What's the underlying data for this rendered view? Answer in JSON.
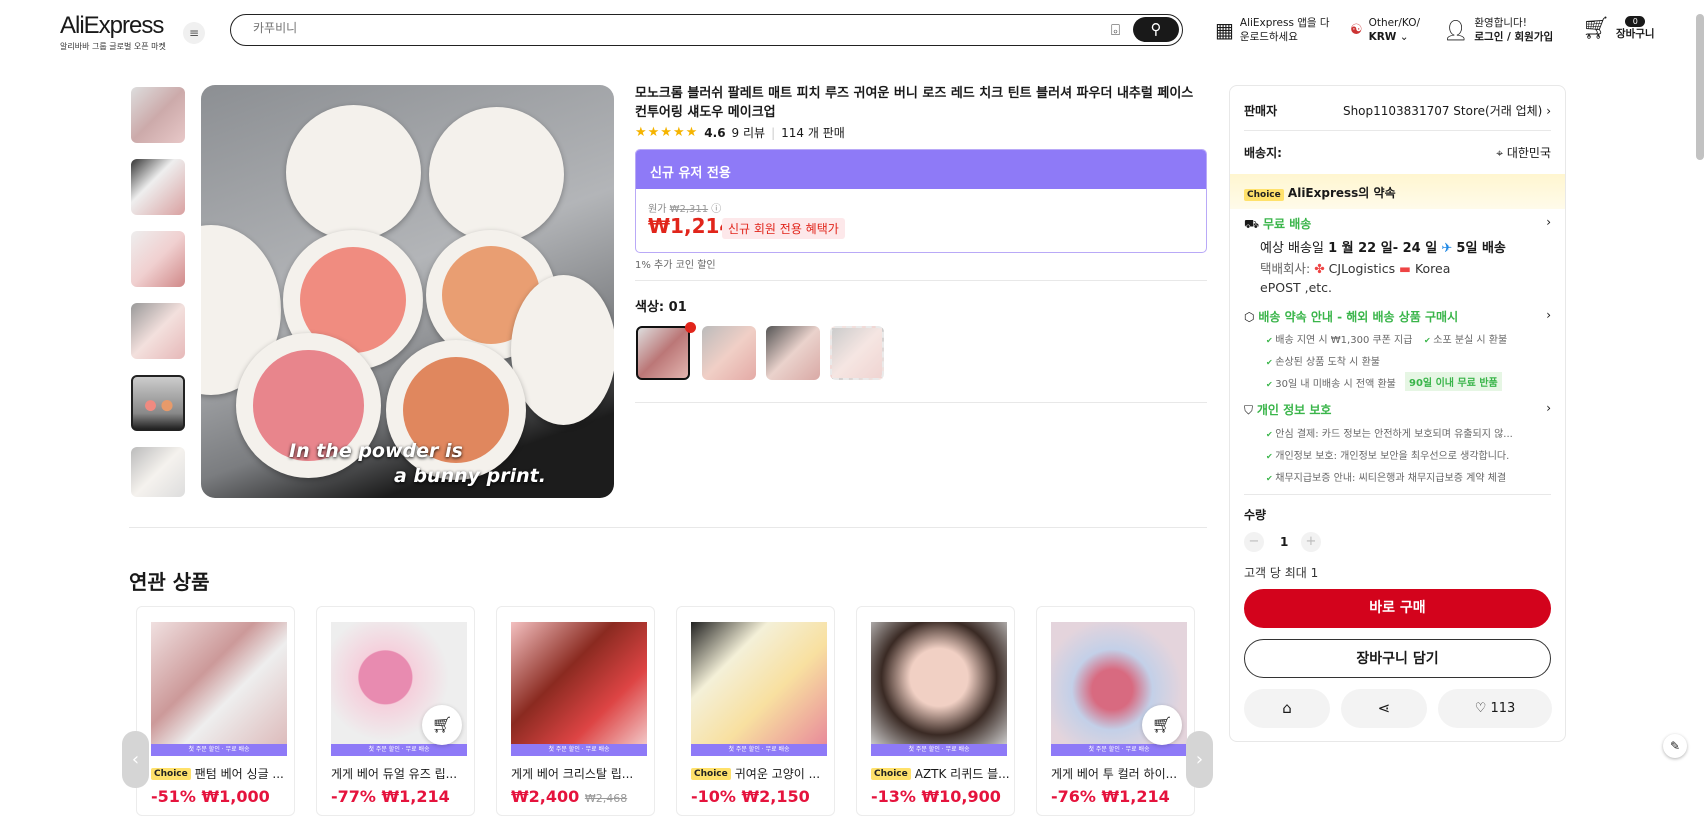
{
  "header": {
    "logo": "AliExpress",
    "logo_sub": "알리바바 그룹 글로벌 오픈 마켓",
    "search_placeholder": "카푸비니",
    "app_line1": "AliExpress 앱을 다",
    "app_line2": "운로드하세요",
    "region_line1": "Other/KO/",
    "region_line2": "KRW",
    "welcome": "환영합니다!",
    "login": "로그인 / 회원가입",
    "cart_count": "0",
    "cart_label": "장바구니"
  },
  "product": {
    "title": "모노크롬 블러쉬 팔레트 매트 피치 루즈 귀여운 버니 로즈 레드 치크 틴트 블러셔 파우더 내추럴 페이스 컨투어링 섀도우 메이크업",
    "stars": "★★★★★",
    "rating": "4.6",
    "reviews": "9 리뷰",
    "sold": "114 개 판매",
    "image_caption_1": "In the powder is",
    "image_caption_2": "a bunny print.",
    "promo_header": "신규 유저 전용",
    "orig_label": "원가",
    "orig_price": "₩2,311",
    "price": "₩1,214",
    "price_tag": "신규 회원 전용 혜택가",
    "coin": "1% 추가 코인 할인",
    "color_label": "색상: 01"
  },
  "panel": {
    "seller_label": "판매자",
    "seller": "Shop1103831707 Store(거래 업체)",
    "ship_label": "배송지:",
    "ship_to": "대한민국",
    "choice_badge": "Choice",
    "choice_text": "AliExpress의 약속",
    "free_ship": "무료 배송",
    "eta_prefix": "예상 배송일",
    "eta": "1 월 22 일- 24 일",
    "eta_days": "5일 배송",
    "carrier": "택배회사:",
    "carrier1": "CJLogistics",
    "carrier2": "Korea",
    "carrier3": "ePOST ,etc.",
    "promise_title": "배송 약속 안내 - 해외 배송 상품 구매시",
    "promise_items": [
      "배송 지연 시 ₩1,300 쿠폰 지급",
      "소포 분실 시 환불",
      "손상된 상품 도착 시 환불",
      "30일 내 미배송 시 전액 환불"
    ],
    "free_return": "90일 이내 무료 반품",
    "privacy_title": "개인 정보 보호",
    "privacy_items": [
      "안심 결제: 카드 정보는 안전하게 보호되며 유출되지 않...",
      "개인정보 보호: 개인정보 보안을 최우선으로 생각합니다.",
      "채무지급보증 안내: 씨티은행과 채무지급보증 계약 체결"
    ],
    "qty_label": "수량",
    "qty": "1",
    "qty_limit": "고객 당 최대 1",
    "buy_now": "바로 구매",
    "add_cart": "장바구니 담기",
    "wish_count": "113"
  },
  "related": {
    "title": "연관 상품",
    "band": "첫 주문 할인 · 무료 배송",
    "items": [
      {
        "choice": "Choice",
        "name": "팬텀 베어 싱글 ...",
        "discount": "-51%",
        "price": "₩1,000",
        "old": ""
      },
      {
        "choice": "",
        "name": "게게 베어 듀얼 유즈 립...",
        "discount": "-77%",
        "price": "₩1,214",
        "old": ""
      },
      {
        "choice": "",
        "name": "게게 베어 크리스탈 립...",
        "discount": "",
        "price": "₩2,400",
        "old": "₩2,468"
      },
      {
        "choice": "Choice",
        "name": "귀여운 고양이 ...",
        "discount": "-10%",
        "price": "₩2,150",
        "old": ""
      },
      {
        "choice": "Choice",
        "name": "AZTK 리퀴드 블...",
        "discount": "-13%",
        "price": "₩10,900",
        "old": ""
      },
      {
        "choice": "",
        "name": "게게 베어 투 컬러 하이...",
        "discount": "-76%",
        "price": "₩1,214",
        "old": ""
      }
    ]
  }
}
